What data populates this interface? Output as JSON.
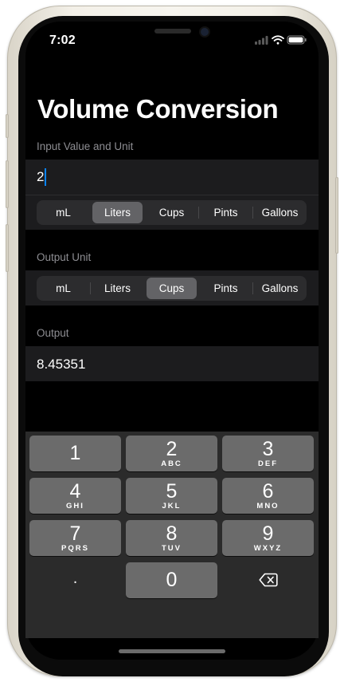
{
  "status_bar": {
    "time": "7:02"
  },
  "title": "Volume Conversion",
  "input_section": {
    "label": "Input Value and Unit",
    "value": "2",
    "units": [
      "mL",
      "Liters",
      "Cups",
      "Pints",
      "Gallons"
    ],
    "selected_unit": "Liters"
  },
  "output_unit_section": {
    "label": "Output Unit",
    "units": [
      "mL",
      "Liters",
      "Cups",
      "Pints",
      "Gallons"
    ],
    "selected_unit": "Cups"
  },
  "output_section": {
    "label": "Output",
    "value": "8.45351"
  },
  "keyboard": {
    "keys": [
      {
        "digit": "1",
        "letters": ""
      },
      {
        "digit": "2",
        "letters": "ABC"
      },
      {
        "digit": "3",
        "letters": "DEF"
      },
      {
        "digit": "4",
        "letters": "GHI"
      },
      {
        "digit": "5",
        "letters": "JKL"
      },
      {
        "digit": "6",
        "letters": "MNO"
      },
      {
        "digit": "7",
        "letters": "PQRS"
      },
      {
        "digit": "8",
        "letters": "TUV"
      },
      {
        "digit": "9",
        "letters": "WXYZ"
      },
      {
        "digit": ".",
        "letters": ""
      },
      {
        "digit": "0",
        "letters": ""
      }
    ],
    "delete_icon": "backspace-icon"
  },
  "colors": {
    "background": "#000000",
    "row_background": "#1c1c1e",
    "segment_selected": "#636366",
    "caret": "#0a84ff",
    "key": "#6b6b6b",
    "keyboard_background": "#2b2b2b"
  }
}
